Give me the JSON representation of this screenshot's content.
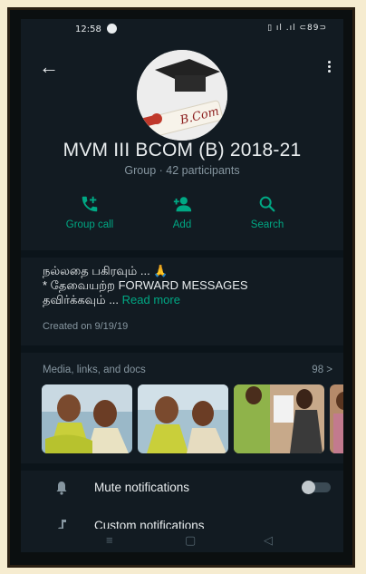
{
  "status_bar": {
    "time": "12:58",
    "right_icons": "▯ ıl .ıl ⊂89⊃"
  },
  "header": {
    "back_icon": "arrow-left-icon",
    "menu_icon": "kebab-menu-icon"
  },
  "group": {
    "avatar_text": "B.Com",
    "name": "MVM III BCOM (B) 2018-21",
    "subtitle": "Group · 42 participants"
  },
  "actions": [
    {
      "label": "Group call",
      "icon": "group-call-icon"
    },
    {
      "label": "Add",
      "icon": "add-person-icon"
    },
    {
      "label": "Search",
      "icon": "search-icon"
    }
  ],
  "description": {
    "line1": "நல்லதை பகிரவும் ... 🙏",
    "line2": "* தேவையற்ற FORWARD MESSAGES",
    "line3": "தவிர்க்கவும் ... ",
    "read_more": "Read more",
    "created": "Created on 9/19/19"
  },
  "media": {
    "title": "Media, links, and docs",
    "count": "98 >"
  },
  "settings": {
    "mute_label": "Mute notifications",
    "mute_enabled": false,
    "custom_label": "Custom notifications"
  },
  "colors": {
    "accent": "#00a884",
    "background": "#121b22",
    "muted_text": "#8696a0"
  }
}
